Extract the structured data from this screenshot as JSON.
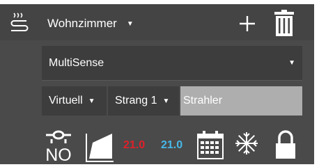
{
  "header": {
    "room": "Wohnzimmer",
    "icons": [
      "underfloor-heating-icon",
      "chevron-down-icon",
      "plus-icon",
      "trash-icon"
    ]
  },
  "mode": {
    "selected": "MultiSense"
  },
  "config": {
    "type": "Virtuell",
    "strand": "Strang 1",
    "name_value": "Strahler"
  },
  "toolbar": {
    "sensor_label": "NO",
    "setpoint_heat": "21.0",
    "setpoint_cool": "21.0",
    "icons": [
      "sensor-no-icon",
      "curve-chart-icon",
      "calendar-icon",
      "frost-icon",
      "lock-icon"
    ]
  },
  "colors": {
    "panel": "#4a4a4a",
    "heat": "#e0202a",
    "cool": "#46b8e8",
    "input_bg": "#aeaeae"
  }
}
